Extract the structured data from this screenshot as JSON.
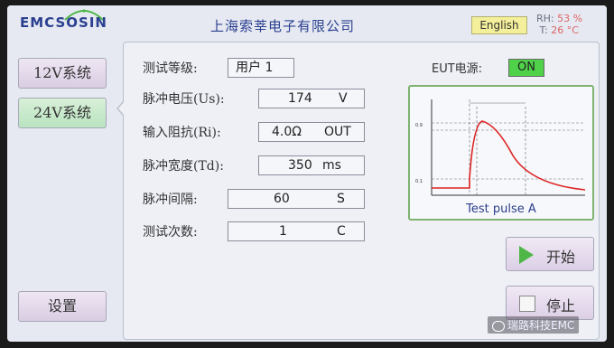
{
  "header": {
    "logo_text": "EMCSOSIN",
    "company": "上海索莘电子有限公司",
    "language_button": "English",
    "rh_label": "RH:",
    "rh_value": "53 %",
    "temp_label": "T:",
    "temp_value": "26 °C"
  },
  "sidebar": {
    "items": [
      {
        "label": "12V系统",
        "active": false
      },
      {
        "label": "24V系统",
        "active": true
      }
    ],
    "settings_label": "设置"
  },
  "params": {
    "level_label": "测试等级:",
    "level_value": "用户 1",
    "voltage_label": "脉冲电压(Us):",
    "voltage_value": "174",
    "voltage_unit": "V",
    "impedance_label": "输入阻抗(Ri):",
    "impedance_value": "4.0Ω",
    "impedance_unit": "OUT",
    "width_label": "脉冲宽度(Td):",
    "width_value": "350",
    "width_unit": "ms",
    "interval_label": "脉冲间隔:",
    "interval_value": "60",
    "interval_unit": "S",
    "count_label": "测试次数:",
    "count_value": "1",
    "count_unit": "C"
  },
  "eut": {
    "label": "EUT电源:",
    "state": "ON",
    "state_color": "#4fd24a"
  },
  "waveform": {
    "caption": "Test pulse A"
  },
  "actions": {
    "start_label": "开始",
    "stop_label": "停止"
  },
  "watermark": {
    "text": "瑞路科技EMC"
  },
  "colors": {
    "accent_blue": "#2a3f8f",
    "active_tab": "#b9e3c0",
    "eut_on": "#4fd24a",
    "wave_border": "#7fb36f"
  }
}
